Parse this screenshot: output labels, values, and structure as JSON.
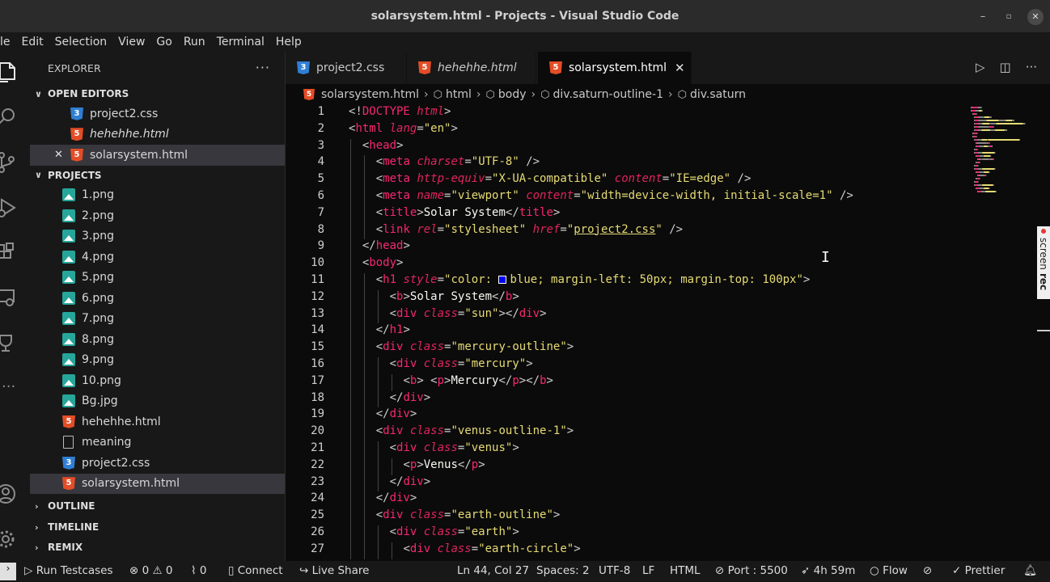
{
  "window": {
    "title": "solarsystem.html - Projects - Visual Studio Code"
  },
  "menu": [
    "le",
    "Edit",
    "Selection",
    "View",
    "Go",
    "Run",
    "Terminal",
    "Help"
  ],
  "explorer": {
    "header": "EXPLORER",
    "more": "···",
    "open_editors_label": "OPEN EDITORS",
    "open_editors": [
      {
        "name": "project2.css",
        "type": "css",
        "italic": false
      },
      {
        "name": "hehehhe.html",
        "type": "html",
        "italic": true
      },
      {
        "name": "solarsystem.html",
        "type": "html",
        "italic": false,
        "active": true
      }
    ],
    "projects_label": "PROJECTS",
    "files": [
      {
        "name": "1.png",
        "type": "img"
      },
      {
        "name": "2.png",
        "type": "img"
      },
      {
        "name": "3.png",
        "type": "img"
      },
      {
        "name": "4.png",
        "type": "img"
      },
      {
        "name": "5.png",
        "type": "img"
      },
      {
        "name": "6.png",
        "type": "img"
      },
      {
        "name": "7.png",
        "type": "img"
      },
      {
        "name": "8.png",
        "type": "img"
      },
      {
        "name": "9.png",
        "type": "img"
      },
      {
        "name": "10.png",
        "type": "img"
      },
      {
        "name": "Bg.jpg",
        "type": "img"
      },
      {
        "name": "hehehhe.html",
        "type": "html"
      },
      {
        "name": "meaning",
        "type": "file"
      },
      {
        "name": "project2.css",
        "type": "css"
      },
      {
        "name": "solarsystem.html",
        "type": "html",
        "selected": true
      }
    ],
    "outline_label": "OUTLINE",
    "timeline_label": "TIMELINE",
    "remix_label": "REMIX"
  },
  "tabs": [
    {
      "label": "project2.css",
      "type": "css"
    },
    {
      "label": "hehehhe.html",
      "type": "html",
      "italic": true
    },
    {
      "label": "solarsystem.html",
      "type": "html",
      "active": true
    }
  ],
  "breadcrumb": [
    "solarsystem.html",
    "html",
    "body",
    "div.saturn-outline-1",
    "div.saturn"
  ],
  "code": [
    [
      [
        "p",
        "<!"
      ],
      [
        "t",
        "DOCTYPE "
      ],
      [
        "a",
        "html"
      ],
      [
        "p",
        ">"
      ]
    ],
    [
      [
        "p",
        "<"
      ],
      [
        "t",
        "html "
      ],
      [
        "a",
        "lang"
      ],
      [
        "p",
        "="
      ],
      [
        "s",
        "\"en\""
      ],
      [
        "p",
        ">"
      ]
    ],
    [
      [
        "p",
        "<"
      ],
      [
        "t",
        "head"
      ],
      [
        "p",
        ">"
      ]
    ],
    [
      [
        "p",
        "<"
      ],
      [
        "t",
        "meta "
      ],
      [
        "a",
        "charset"
      ],
      [
        "p",
        "="
      ],
      [
        "s",
        "\"UTF-8\""
      ],
      [
        "p",
        " />"
      ]
    ],
    [
      [
        "p",
        "<"
      ],
      [
        "t",
        "meta "
      ],
      [
        "a",
        "http-equiv"
      ],
      [
        "p",
        "="
      ],
      [
        "s",
        "\"X-UA-compatible\""
      ],
      [
        "p",
        " "
      ],
      [
        "a",
        "content"
      ],
      [
        "p",
        "="
      ],
      [
        "s",
        "\"IE=edge\""
      ],
      [
        "p",
        " />"
      ]
    ],
    [
      [
        "p",
        "<"
      ],
      [
        "t",
        "meta "
      ],
      [
        "a",
        "name"
      ],
      [
        "p",
        "="
      ],
      [
        "s",
        "\"viewport\""
      ],
      [
        "p",
        " "
      ],
      [
        "a",
        "content"
      ],
      [
        "p",
        "="
      ],
      [
        "s",
        "\"width=device-width, initial-scale=1\""
      ],
      [
        "p",
        " />"
      ]
    ],
    [
      [
        "p",
        "<"
      ],
      [
        "t",
        "title"
      ],
      [
        "p",
        ">"
      ],
      [
        "txt",
        "Solar System"
      ],
      [
        "p",
        "</"
      ],
      [
        "t",
        "title"
      ],
      [
        "p",
        ">"
      ]
    ],
    [
      [
        "p",
        "<"
      ],
      [
        "t",
        "link "
      ],
      [
        "a",
        "rel"
      ],
      [
        "p",
        "="
      ],
      [
        "s",
        "\"stylesheet\""
      ],
      [
        "p",
        " "
      ],
      [
        "a",
        "href"
      ],
      [
        "p",
        "="
      ],
      [
        "s",
        "\""
      ],
      [
        "su",
        "project2.css"
      ],
      [
        "s",
        "\""
      ],
      [
        "p",
        " />"
      ]
    ],
    [
      [
        "p",
        "</"
      ],
      [
        "t",
        "head"
      ],
      [
        "p",
        ">"
      ]
    ],
    [
      [
        "p",
        "<"
      ],
      [
        "t",
        "body"
      ],
      [
        "p",
        ">"
      ]
    ],
    [
      [
        "p",
        "<"
      ],
      [
        "t",
        "h1 "
      ],
      [
        "a",
        "style"
      ],
      [
        "p",
        "="
      ],
      [
        "s",
        "\"color: "
      ],
      [
        "swatch",
        ""
      ],
      [
        "s",
        "blue; margin-left: 50px; margin-top: 100px\""
      ],
      [
        "p",
        ">"
      ]
    ],
    [
      [
        "p",
        "<"
      ],
      [
        "t",
        "b"
      ],
      [
        "p",
        ">"
      ],
      [
        "txt",
        "Solar System"
      ],
      [
        "p",
        "</"
      ],
      [
        "t",
        "b"
      ],
      [
        "p",
        ">"
      ]
    ],
    [
      [
        "p",
        "<"
      ],
      [
        "t",
        "div "
      ],
      [
        "a",
        "class"
      ],
      [
        "p",
        "="
      ],
      [
        "s",
        "\"sun\""
      ],
      [
        "p",
        "></"
      ],
      [
        "t",
        "div"
      ],
      [
        "p",
        ">"
      ]
    ],
    [
      [
        "p",
        "</"
      ],
      [
        "t",
        "h1"
      ],
      [
        "p",
        ">"
      ]
    ],
    [
      [
        "p",
        "<"
      ],
      [
        "t",
        "div "
      ],
      [
        "a",
        "class"
      ],
      [
        "p",
        "="
      ],
      [
        "s",
        "\"mercury-outline\""
      ],
      [
        "p",
        ">"
      ]
    ],
    [
      [
        "p",
        "<"
      ],
      [
        "t",
        "div "
      ],
      [
        "a",
        "class"
      ],
      [
        "p",
        "="
      ],
      [
        "s",
        "\"mercury\""
      ],
      [
        "p",
        ">"
      ]
    ],
    [
      [
        "p",
        "<"
      ],
      [
        "t",
        "b"
      ],
      [
        "p",
        "> <"
      ],
      [
        "t",
        "p"
      ],
      [
        "p",
        ">"
      ],
      [
        "txt",
        "Mercury"
      ],
      [
        "p",
        "</"
      ],
      [
        "t",
        "p"
      ],
      [
        "p",
        "></"
      ],
      [
        "t",
        "b"
      ],
      [
        "p",
        ">"
      ]
    ],
    [
      [
        "p",
        "</"
      ],
      [
        "t",
        "div"
      ],
      [
        "p",
        ">"
      ]
    ],
    [
      [
        "p",
        "</"
      ],
      [
        "t",
        "div"
      ],
      [
        "p",
        ">"
      ]
    ],
    [
      [
        "p",
        "<"
      ],
      [
        "t",
        "div "
      ],
      [
        "a",
        "class"
      ],
      [
        "p",
        "="
      ],
      [
        "s",
        "\"venus-outline-1\""
      ],
      [
        "p",
        ">"
      ]
    ],
    [
      [
        "p",
        "<"
      ],
      [
        "t",
        "div "
      ],
      [
        "a",
        "class"
      ],
      [
        "p",
        "="
      ],
      [
        "s",
        "\"venus\""
      ],
      [
        "p",
        ">"
      ]
    ],
    [
      [
        "p",
        "<"
      ],
      [
        "t",
        "p"
      ],
      [
        "p",
        ">"
      ],
      [
        "txt",
        "Venus"
      ],
      [
        "p",
        "</"
      ],
      [
        "t",
        "p"
      ],
      [
        "p",
        ">"
      ]
    ],
    [
      [
        "p",
        "</"
      ],
      [
        "t",
        "div"
      ],
      [
        "p",
        ">"
      ]
    ],
    [
      [
        "p",
        "</"
      ],
      [
        "t",
        "div"
      ],
      [
        "p",
        ">"
      ]
    ],
    [
      [
        "p",
        "<"
      ],
      [
        "t",
        "div "
      ],
      [
        "a",
        "class"
      ],
      [
        "p",
        "="
      ],
      [
        "s",
        "\"earth-outline\""
      ],
      [
        "p",
        ">"
      ]
    ],
    [
      [
        "p",
        "<"
      ],
      [
        "t",
        "div "
      ],
      [
        "a",
        "class"
      ],
      [
        "p",
        "="
      ],
      [
        "s",
        "\"earth\""
      ],
      [
        "p",
        ">"
      ]
    ],
    [
      [
        "p",
        "<"
      ],
      [
        "t",
        "div "
      ],
      [
        "a",
        "class"
      ],
      [
        "p",
        "="
      ],
      [
        "s",
        "\"earth-circle\""
      ],
      [
        "p",
        ">"
      ]
    ]
  ],
  "indents": [
    0,
    0,
    1,
    2,
    2,
    2,
    2,
    2,
    1,
    1,
    2,
    3,
    3,
    2,
    2,
    3,
    4,
    3,
    2,
    2,
    3,
    4,
    3,
    2,
    2,
    3,
    4
  ],
  "line_numbers": [
    "1",
    "2",
    "3",
    "4",
    "5",
    "6",
    "7",
    "8",
    "9",
    "10",
    "11",
    "12",
    "13",
    "14",
    "15",
    "16",
    "17",
    "18",
    "19",
    "20",
    "21",
    "22",
    "23",
    "24",
    "25",
    "26",
    "27"
  ],
  "statusbar": {
    "run_testcases": "Run Testcases",
    "errors": "0",
    "warnings": "0",
    "ports": "0",
    "connect": "Connect",
    "live_share": "Live Share",
    "cursor": "Ln 44, Col 27",
    "spaces": "Spaces: 2",
    "encoding": "UTF-8",
    "eol": "LF",
    "language": "HTML",
    "port": "Port : 5500",
    "timer": "4h 59m",
    "flow": "Flow",
    "prettier": "Prettier"
  },
  "colors": {
    "tag": "#f92672",
    "string": "#e6db74",
    "swatch": "#0000ff",
    "html_icon": "#e44d26",
    "css_icon": "#2f7fd4",
    "img_icon": "#26a69a"
  }
}
